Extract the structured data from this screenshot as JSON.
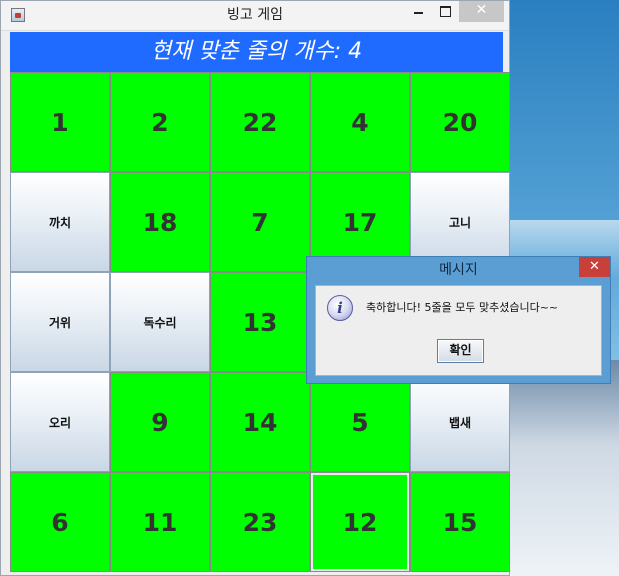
{
  "window": {
    "title": "빙고 게임",
    "close_glyph": "✕"
  },
  "header": {
    "text": "현재 맞춘 줄의 개수: 4"
  },
  "board": {
    "cells": [
      {
        "text": "1",
        "type": "number",
        "matched": true
      },
      {
        "text": "2",
        "type": "number",
        "matched": true
      },
      {
        "text": "22",
        "type": "number",
        "matched": true
      },
      {
        "text": "4",
        "type": "number",
        "matched": true
      },
      {
        "text": "20",
        "type": "number",
        "matched": true
      },
      {
        "text": "까치",
        "type": "word",
        "matched": false
      },
      {
        "text": "18",
        "type": "number",
        "matched": true
      },
      {
        "text": "7",
        "type": "number",
        "matched": true
      },
      {
        "text": "17",
        "type": "number",
        "matched": true
      },
      {
        "text": "고니",
        "type": "word",
        "matched": false
      },
      {
        "text": "거위",
        "type": "word",
        "matched": false
      },
      {
        "text": "독수리",
        "type": "word",
        "matched": false
      },
      {
        "text": "13",
        "type": "number",
        "matched": true
      },
      {
        "text": "",
        "type": "number",
        "matched": true
      },
      {
        "text": "",
        "type": "number",
        "matched": true
      },
      {
        "text": "오리",
        "type": "word",
        "matched": false
      },
      {
        "text": "9",
        "type": "number",
        "matched": true
      },
      {
        "text": "14",
        "type": "number",
        "matched": true
      },
      {
        "text": "5",
        "type": "number",
        "matched": true
      },
      {
        "text": "뱁새",
        "type": "word",
        "matched": false
      },
      {
        "text": "6",
        "type": "number",
        "matched": true
      },
      {
        "text": "11",
        "type": "number",
        "matched": true
      },
      {
        "text": "23",
        "type": "number",
        "matched": true
      },
      {
        "text": "12",
        "type": "number",
        "matched": true
      },
      {
        "text": "15",
        "type": "number",
        "matched": true
      }
    ]
  },
  "dialog": {
    "title": "메시지",
    "close_glyph": "✕",
    "message": "축하합니다! 5줄을 모두 맞추셨습니다~~",
    "icon_glyph": "i",
    "ok_label": "확인"
  },
  "colors": {
    "header_bg": "#1f6bff",
    "matched_cell": "#00ff00",
    "dialog_frame": "#5b9ed4",
    "close_button": "#c7403a"
  }
}
